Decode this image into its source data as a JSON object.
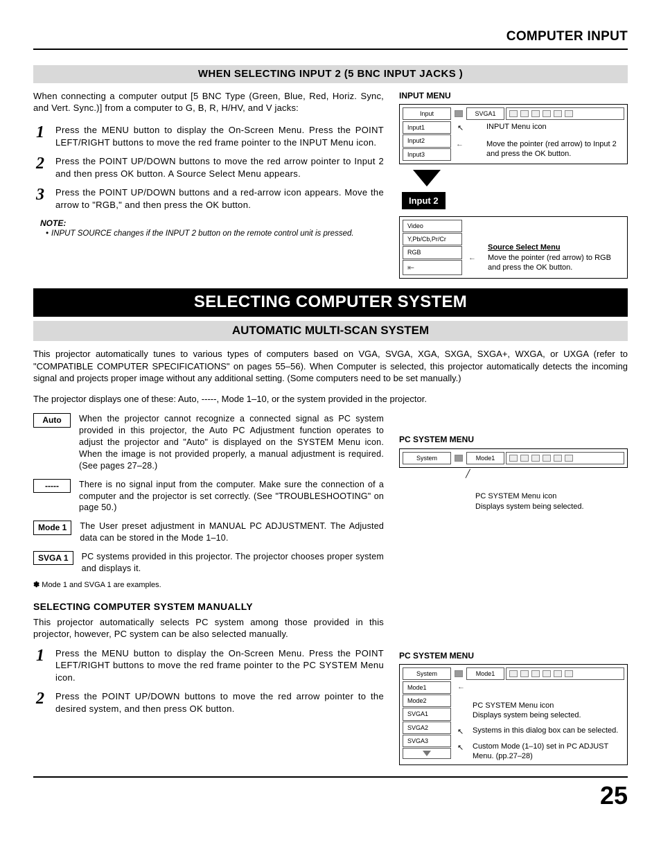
{
  "header": {
    "title": "COMPUTER INPUT"
  },
  "section1": {
    "band": "WHEN SELECTING INPUT 2 (5 BNC INPUT JACKS )",
    "intro": "When connecting a computer output [5 BNC Type (Green, Blue, Red, Horiz. Sync, and Vert. Sync.)] from a computer to G, B, R, H/HV, and V jacks:",
    "steps": [
      "Press the MENU button to display the On-Screen Menu. Press the POINT LEFT/RIGHT buttons to move the red frame pointer to the INPUT Menu icon.",
      "Press the POINT UP/DOWN buttons to move the red arrow pointer to Input 2 and then press OK button. A Source Select Menu appears.",
      "Press the POINT UP/DOWN buttons and a red-arrow icon appears. Move the arrow to \"RGB,\" and then press the OK button."
    ],
    "note_label": "NOTE:",
    "note_body": "INPUT SOURCE changes if the INPUT 2 button on the remote control unit is pressed."
  },
  "input_menu": {
    "title": "INPUT MENU",
    "top_label": "Input",
    "system_label": "SVGA1",
    "list": [
      "Input1",
      "Input2",
      "Input3"
    ],
    "annot1": "INPUT Menu icon",
    "annot2": "Move the pointer (red arrow) to Input 2 and press the OK button.",
    "input2_tag": "Input 2",
    "source_list": [
      "Video",
      "Y,Pb/Cb,Pr/Cr",
      "RGB"
    ],
    "source_heading": "Source Select Menu",
    "annot3": "Move the pointer (red arrow) to RGB and press the OK button."
  },
  "section2": {
    "title_bar": "SELECTING COMPUTER SYSTEM",
    "subtitle": "AUTOMATIC MULTI-SCAN SYSTEM",
    "p1": "This projector automatically tunes to various types of computers based on VGA, SVGA, XGA, SXGA, SXGA+, WXGA, or UXGA (refer to \"COMPATIBLE COMPUTER SPECIFICATIONS\" on pages 55–56). When Computer is selected, this projector automatically detects the incoming signal and projects proper image without any additional setting. (Some computers need to be set manually.)",
    "p2": "The projector displays one of these: Auto, -----, Mode 1–10, or the system provided in the projector.",
    "modes": [
      {
        "badge": "Auto",
        "desc": "When the projector cannot recognize a connected signal as PC system provided in this projector, the Auto PC Adjustment function operates to adjust the projector and \"Auto\" is displayed on the SYSTEM Menu icon. When the image is not provided properly, a manual adjustment is required. (See pages 27–28.)"
      },
      {
        "badge": "-----",
        "desc": "There is no signal input from the computer. Make sure the connection of a computer and the projector is set correctly. (See \"TROUBLESHOOTING\" on page 50.)"
      },
      {
        "badge": "Mode 1",
        "desc": "The User preset adjustment in MANUAL PC ADJUSTMENT. The Adjusted data can be stored in the Mode 1–10."
      },
      {
        "badge": "SVGA 1",
        "desc": "PC systems provided in this projector. The projector chooses proper system and displays it."
      }
    ],
    "footnote": "Mode 1 and SVGA 1 are examples."
  },
  "pc_menu1": {
    "title": "PC SYSTEM MENU",
    "top_label": "System",
    "system_label": "Mode1",
    "annot": "PC SYSTEM Menu icon\nDisplays system being selected."
  },
  "section3": {
    "subhead": "SELECTING COMPUTER SYSTEM MANUALLY",
    "intro": "This projector automatically selects PC system among those provided in this projector, however, PC system can be also selected manually.",
    "steps": [
      "Press the MENU button to display the On-Screen Menu. Press the POINT LEFT/RIGHT buttons to move the red frame pointer to the PC SYSTEM Menu icon.",
      "Press the POINT UP/DOWN buttons to move the red arrow pointer to the desired system, and then press OK button."
    ]
  },
  "pc_menu2": {
    "title": "PC SYSTEM MENU",
    "top_label": "System",
    "system_label": "Mode1",
    "list": [
      "Mode1",
      "Mode2",
      "SVGA1",
      "SVGA2",
      "SVGA3"
    ],
    "annot1": "PC SYSTEM Menu icon\nDisplays system being selected.",
    "annot2": "Systems in this dialog box can be selected.",
    "annot3": "Custom Mode (1–10) set in PC ADJUST Menu. (pp.27–28)"
  },
  "page_number": "25"
}
